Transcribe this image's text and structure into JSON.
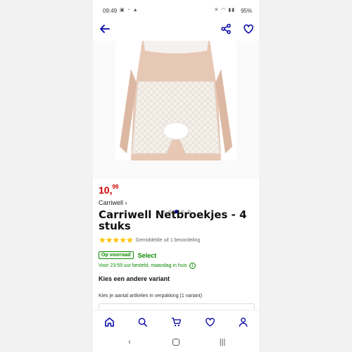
{
  "status_bar": {
    "time": "09:49",
    "battery": "95%"
  },
  "product": {
    "price_whole": "10,",
    "price_fraction": "99",
    "brand_link": "Carriwell ›",
    "title": "Carriwell Netbroekjes - 4 stuks",
    "stars": "★★★★★",
    "rating_text": "Gemiddelde uit 1 beoordeling",
    "badge": "Op voorraad",
    "select_label": "Select",
    "delivery": "Voor 23:59 uur besteld, maandag in huis",
    "variant_heading": "Kies een andere variant",
    "variant_sub": "Kies je aantal artikelen in verpakking (1 variant)"
  },
  "gallery": {
    "dot_count": 5,
    "active_index": 2
  },
  "colors": {
    "brand_blue": "#0000a4",
    "price_red": "#cc0000",
    "stock_green": "#0b8a00",
    "star_yellow": "#ffc200"
  },
  "icons": {
    "top_nav": [
      "back-arrow-icon",
      "share-icon",
      "heart-icon"
    ],
    "tab_bar": [
      "home-icon",
      "search-icon",
      "cart-icon",
      "heart-icon",
      "account-icon"
    ],
    "system_nav": [
      "back-chevron-icon",
      "home-circle-icon",
      "recents-icon"
    ]
  }
}
